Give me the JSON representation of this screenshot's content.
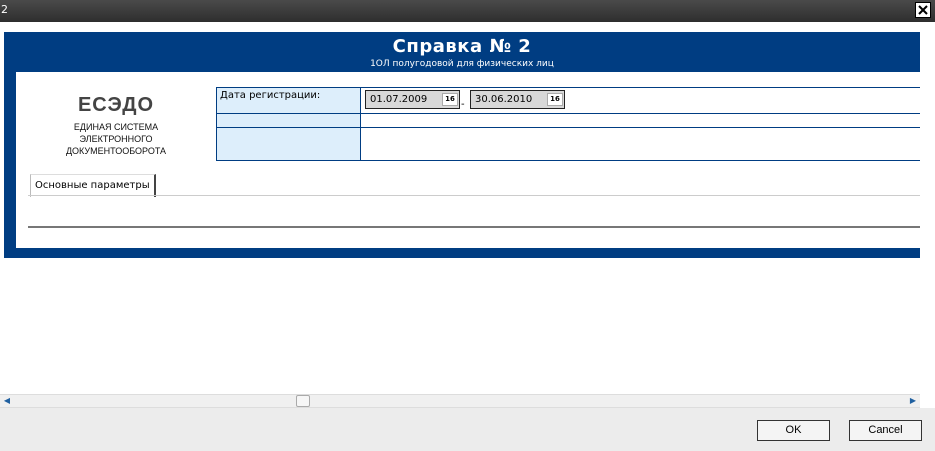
{
  "window": {
    "title": "2"
  },
  "doc": {
    "title": "Справка № 2",
    "subtitle": "1ОЛ полугодовой для физических лиц"
  },
  "logo": {
    "main": "ЕСЭДО",
    "line1": "ЕДИНАЯ СИСТЕМА",
    "line2": "ЭЛЕКТРОННОГО",
    "line3": "ДОКУМЕНТООБОРОТА"
  },
  "form": {
    "reg_date_label": "Дата регистрации:",
    "date_from": "01.07.2009",
    "date_to": "30.06.2010",
    "date_separator": "-",
    "calendar_icon_text": "16"
  },
  "tabs": [
    {
      "label": "Основные параметры"
    }
  ],
  "footer": {
    "ok_label": "OK",
    "cancel_label": "Cancel"
  },
  "colors": {
    "frame": "#003d82",
    "label_bg": "#ddeefb",
    "titlebar": "#3a3a3a"
  }
}
